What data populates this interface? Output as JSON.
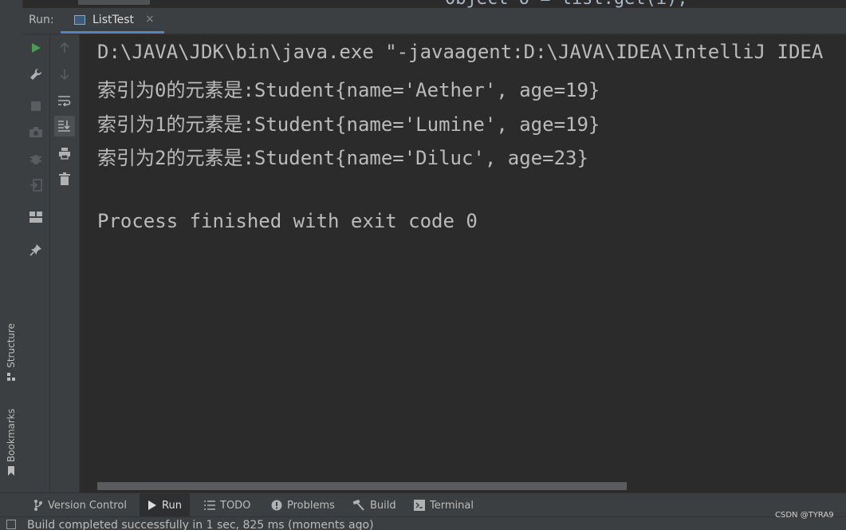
{
  "editor_peek": {
    "code_fragment": "Object o = list.get(i);"
  },
  "run_panel": {
    "label": "Run:",
    "tab": {
      "title": "ListTest",
      "close": "×"
    }
  },
  "console": {
    "lines": [
      "D:\\JAVA\\JDK\\bin\\java.exe \"-javaagent:D:\\JAVA\\IDEA\\IntelliJ IDEA",
      "索引为0的元素是:Student{name='Aether', age=19}",
      "索引为1的元素是:Student{name='Lumine', age=19}",
      "索引为2的元素是:Student{name='Diluc', age=23}",
      "",
      "Process finished with exit code 0"
    ]
  },
  "left_strip": {
    "structure_label": "Structure",
    "bookmarks_label": "Bookmarks"
  },
  "bottom_tabs": [
    {
      "label": "Version Control",
      "icon": "branch-icon"
    },
    {
      "label": "Run",
      "icon": "run-icon"
    },
    {
      "label": "TODO",
      "icon": "list-icon"
    },
    {
      "label": "Problems",
      "icon": "problems-icon"
    },
    {
      "label": "Build",
      "icon": "hammer-icon"
    },
    {
      "label": "Terminal",
      "icon": "terminal-icon"
    }
  ],
  "status_bar": {
    "message": "Build completed successfully in 1 sec, 825 ms (moments ago)"
  },
  "watermark": "CSDN @TYRA9",
  "colors": {
    "run_green": "#499c54",
    "accent_blue": "#4a88c7",
    "console_text": "#bbbbbb",
    "panel_bg": "#3c3f41",
    "console_bg": "#2b2b2b"
  }
}
